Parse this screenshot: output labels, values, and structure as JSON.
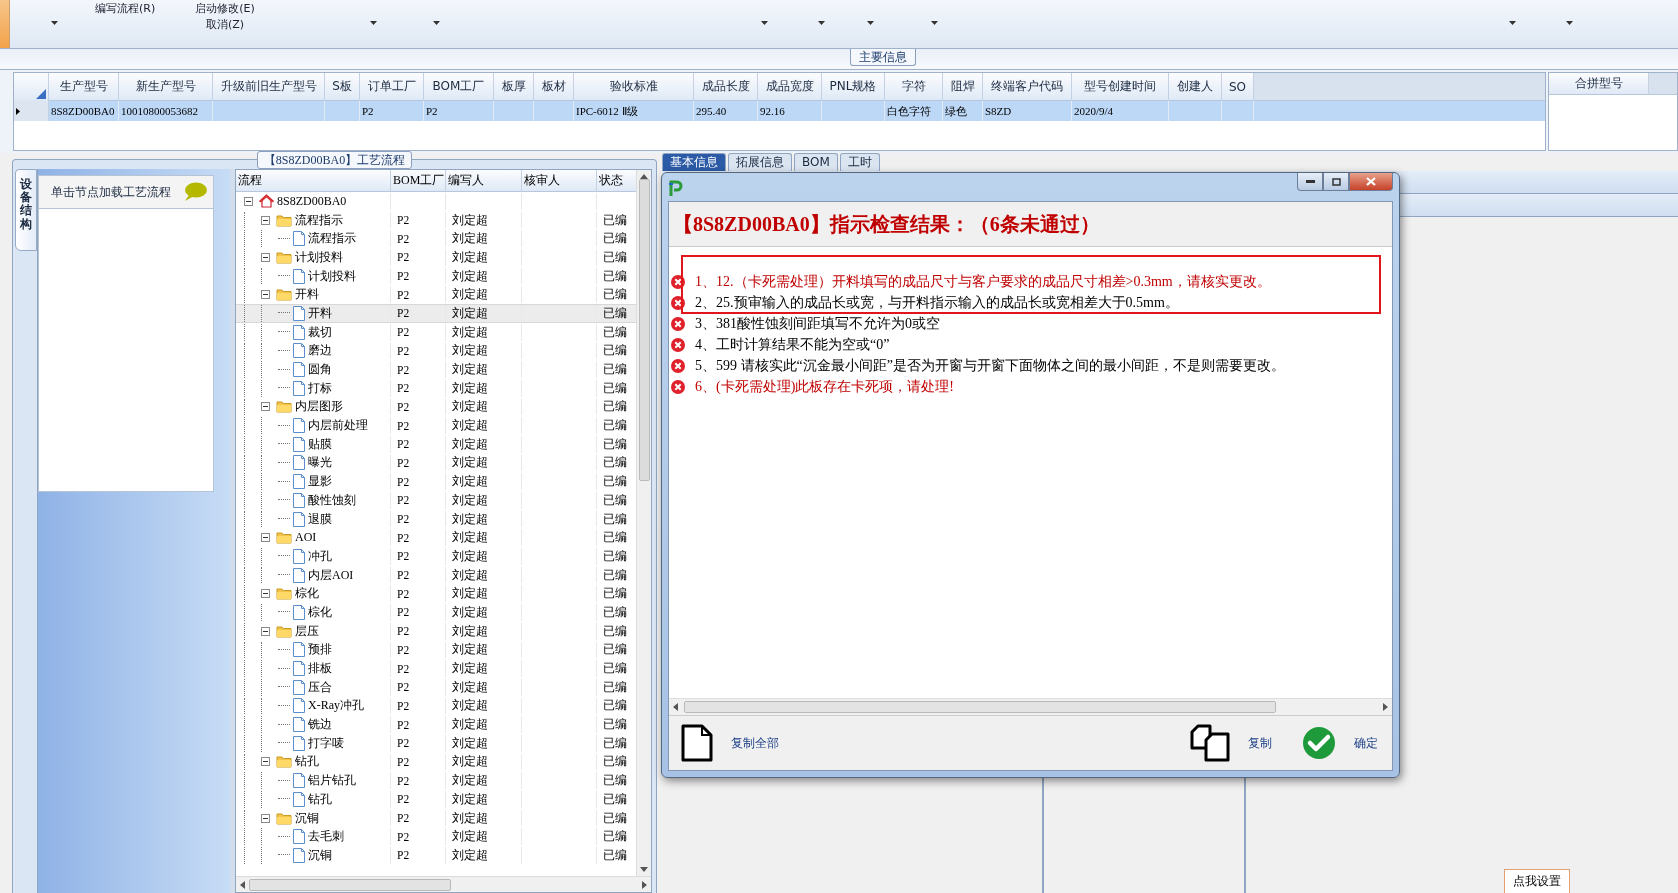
{
  "toolbar": {
    "groups": [
      [
        "编写流程(R)"
      ],
      [
        "启动修改(E)",
        "取消(Z)"
      ]
    ]
  },
  "main_info": {
    "legend": "主要信息",
    "grid": {
      "columns": [
        "生产型号",
        "新生产型号",
        "升级前旧生产型号",
        "S板",
        "订单工厂",
        "BOM工厂",
        "板厚",
        "板材",
        "验收标准",
        "成品长度",
        "成品宽度",
        "PNL规格",
        "字符",
        "阻焊",
        "终端客户代码",
        "型号创建时间",
        "创建人",
        "SO"
      ],
      "rows": [
        {
          "selected": true,
          "cells": [
            "8S8ZD00BA0",
            "10010800053682",
            null,
            null,
            "P2",
            "P2",
            null,
            null,
            "IPC-6012 Ⅱ级",
            "295.40",
            "92.16",
            null,
            "白色字符",
            "绿色",
            "S8ZD",
            "2020/9/4",
            null,
            null
          ]
        }
      ]
    },
    "side_grid": {
      "columns": [
        "合拼型号"
      ]
    }
  },
  "process_panel": {
    "legend": "【8S8ZD00BA0】工艺流程",
    "side_tab": "设备结构",
    "hint": "单击节点加载工艺流程",
    "tree": {
      "columns": [
        "流程",
        "BOM工厂",
        "编写人",
        "核审人",
        "状态"
      ],
      "nodes": [
        {
          "name": "8S8ZD00BA0",
          "kind": "root",
          "expanded": true,
          "selected": false,
          "children": [
            {
              "name": "流程指示",
              "kind": "folder",
              "factory": "P2",
              "writer": "刘定超",
              "status": "已编",
              "expanded": true,
              "selected": false,
              "children": [
                {
                  "name": "流程指示",
                  "kind": "file",
                  "factory": "P2",
                  "writer": "刘定超",
                  "status": "已编",
                  "selected": false
                }
              ]
            },
            {
              "name": "计划投料",
              "kind": "folder",
              "factory": "P2",
              "writer": "刘定超",
              "status": "已编",
              "expanded": true,
              "selected": false,
              "children": [
                {
                  "name": "计划投料",
                  "kind": "file",
                  "factory": "P2",
                  "writer": "刘定超",
                  "status": "已编",
                  "selected": false
                }
              ]
            },
            {
              "name": "开料",
              "kind": "folder",
              "factory": "P2",
              "writer": "刘定超",
              "status": "已编",
              "expanded": true,
              "selected": false,
              "children": [
                {
                  "name": "开料",
                  "kind": "file",
                  "factory": "P2",
                  "writer": "刘定超",
                  "status": "已编",
                  "selected": true
                },
                {
                  "name": "裁切",
                  "kind": "file",
                  "factory": "P2",
                  "writer": "刘定超",
                  "status": "已编",
                  "selected": false
                },
                {
                  "name": "磨边",
                  "kind": "file",
                  "factory": "P2",
                  "writer": "刘定超",
                  "status": "已编",
                  "selected": false
                },
                {
                  "name": "圆角",
                  "kind": "file",
                  "factory": "P2",
                  "writer": "刘定超",
                  "status": "已编",
                  "selected": false
                },
                {
                  "name": "打标",
                  "kind": "file",
                  "factory": "P2",
                  "writer": "刘定超",
                  "status": "已编",
                  "selected": false
                }
              ]
            },
            {
              "name": "内层图形",
              "kind": "folder",
              "factory": "P2",
              "writer": "刘定超",
              "status": "已编",
              "expanded": true,
              "selected": false,
              "children": [
                {
                  "name": "内层前处理",
                  "kind": "file",
                  "factory": "P2",
                  "writer": "刘定超",
                  "status": "已编",
                  "selected": false
                },
                {
                  "name": "贴膜",
                  "kind": "file",
                  "factory": "P2",
                  "writer": "刘定超",
                  "status": "已编",
                  "selected": false
                },
                {
                  "name": "曝光",
                  "kind": "file",
                  "factory": "P2",
                  "writer": "刘定超",
                  "status": "已编",
                  "selected": false
                },
                {
                  "name": "显影",
                  "kind": "file",
                  "factory": "P2",
                  "writer": "刘定超",
                  "status": "已编",
                  "selected": false
                },
                {
                  "name": "酸性蚀刻",
                  "kind": "file",
                  "factory": "P2",
                  "writer": "刘定超",
                  "status": "已编",
                  "selected": false
                },
                {
                  "name": "退膜",
                  "kind": "file",
                  "factory": "P2",
                  "writer": "刘定超",
                  "status": "已编",
                  "selected": false
                }
              ]
            },
            {
              "name": "AOI",
              "kind": "folder",
              "factory": "P2",
              "writer": "刘定超",
              "status": "已编",
              "expanded": true,
              "selected": false,
              "children": [
                {
                  "name": "冲孔",
                  "kind": "file",
                  "factory": "P2",
                  "writer": "刘定超",
                  "status": "已编",
                  "selected": false
                },
                {
                  "name": "内层AOI",
                  "kind": "file",
                  "factory": "P2",
                  "writer": "刘定超",
                  "status": "已编",
                  "selected": false
                }
              ]
            },
            {
              "name": "棕化",
              "kind": "folder",
              "factory": "P2",
              "writer": "刘定超",
              "status": "已编",
              "expanded": true,
              "selected": false,
              "children": [
                {
                  "name": "棕化",
                  "kind": "file",
                  "factory": "P2",
                  "writer": "刘定超",
                  "status": "已编",
                  "selected": false
                }
              ]
            },
            {
              "name": "层压",
              "kind": "folder",
              "factory": "P2",
              "writer": "刘定超",
              "status": "已编",
              "expanded": true,
              "selected": false,
              "children": [
                {
                  "name": "预排",
                  "kind": "file",
                  "factory": "P2",
                  "writer": "刘定超",
                  "status": "已编",
                  "selected": false
                },
                {
                  "name": "排板",
                  "kind": "file",
                  "factory": "P2",
                  "writer": "刘定超",
                  "status": "已编",
                  "selected": false
                },
                {
                  "name": "压合",
                  "kind": "file",
                  "factory": "P2",
                  "writer": "刘定超",
                  "status": "已编",
                  "selected": false
                },
                {
                  "name": "X-Ray冲孔",
                  "kind": "file",
                  "factory": "P2",
                  "writer": "刘定超",
                  "status": "已编",
                  "selected": false
                },
                {
                  "name": "铣边",
                  "kind": "file",
                  "factory": "P2",
                  "writer": "刘定超",
                  "status": "已编",
                  "selected": false
                },
                {
                  "name": "打字唛",
                  "kind": "file",
                  "factory": "P2",
                  "writer": "刘定超",
                  "status": "已编",
                  "selected": false
                }
              ]
            },
            {
              "name": "钻孔",
              "kind": "folder",
              "factory": "P2",
              "writer": "刘定超",
              "status": "已编",
              "expanded": true,
              "selected": false,
              "children": [
                {
                  "name": "铝片钻孔",
                  "kind": "file",
                  "factory": "P2",
                  "writer": "刘定超",
                  "status": "已编",
                  "selected": false
                },
                {
                  "name": "钻孔",
                  "kind": "file",
                  "factory": "P2",
                  "writer": "刘定超",
                  "status": "已编",
                  "selected": false
                }
              ]
            },
            {
              "name": "沉铜",
              "kind": "folder",
              "factory": "P2",
              "writer": "刘定超",
              "status": "已编",
              "expanded": true,
              "selected": false,
              "children": [
                {
                  "name": "去毛刺",
                  "kind": "file",
                  "factory": "P2",
                  "writer": "刘定超",
                  "status": "已编",
                  "selected": false
                },
                {
                  "name": "沉铜",
                  "kind": "file",
                  "factory": "P2",
                  "writer": "刘定超",
                  "status": "已编",
                  "selected": false
                }
              ]
            }
          ]
        }
      ]
    }
  },
  "detail_tabs": [
    {
      "label": "基本信息",
      "selected": true
    },
    {
      "label": "拓展信息",
      "selected": false
    },
    {
      "label": "BOM",
      "selected": false
    },
    {
      "label": "工时",
      "selected": false
    }
  ],
  "settings_button": "点我设置",
  "dialog": {
    "heading": "【8S8ZD00BA0】指示检查结果：（6条未通过）",
    "items": [
      {
        "text": "1、12.（卡死需处理）开料填写的成品尺寸与客户要求的成品尺寸相差>0.3mm，请核实更改。",
        "color": "#c00000",
        "boxed": true
      },
      {
        "text": "2、25.预审输入的成品长或宽，与开料指示输入的成品长或宽相差大于0.5mm。",
        "color": "#000000",
        "boxed": true
      },
      {
        "text": "3、381酸性蚀刻间距填写不允许为0或空",
        "color": "#000000",
        "boxed": false
      },
      {
        "text": "4、工时计算结果不能为空或“0”",
        "color": "#000000",
        "boxed": false
      },
      {
        "text": "5、599 请核实此“沉金最小间距”是否为开窗与开窗下面物体之间的最小间距，不是则需要更改。",
        "color": "#000000",
        "boxed": false
      },
      {
        "text": "6、(卡死需处理)此板存在卡死项，请处理!",
        "color": "#c00000",
        "boxed": false
      }
    ],
    "buttons": [
      {
        "kind": "copy_all",
        "label": "复制全部"
      },
      {
        "kind": "copy",
        "label": "复制"
      },
      {
        "kind": "ok",
        "label": "确定"
      }
    ]
  }
}
